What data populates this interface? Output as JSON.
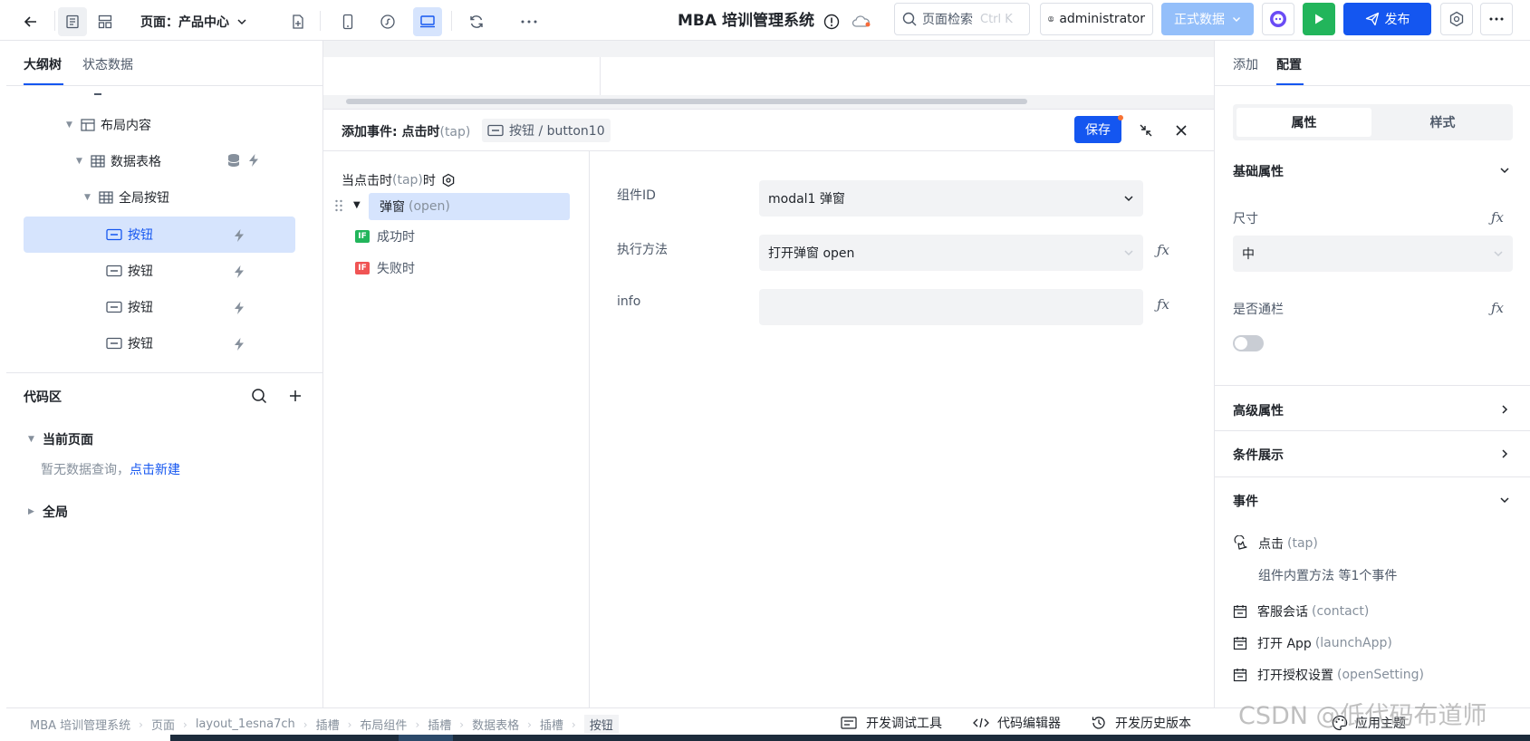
{
  "topbar": {
    "page_label": "页面：产品中心",
    "app_title": "MBA 培训管理系统",
    "search_placeholder": "页面检索",
    "search_shortcut": "Ctrl K",
    "user_name": "administrator",
    "env_label": "正式数据",
    "publish_label": "发布"
  },
  "left": {
    "tabs": [
      "大纲树",
      "状态数据"
    ],
    "tree": [
      {
        "label": "布局内容",
        "icon": "layout-icon"
      },
      {
        "label": "数据表格",
        "icon": "table-icon"
      },
      {
        "label": "全局按钮",
        "icon": "table-icon"
      },
      {
        "label": "按钮",
        "icon": "button-icon"
      },
      {
        "label": "按钮",
        "icon": "button-icon"
      },
      {
        "label": "按钮",
        "icon": "button-icon"
      },
      {
        "label": "按钮",
        "icon": "button-icon"
      }
    ],
    "code_area": {
      "title": "代码区",
      "current_page": "当前页面",
      "empty_text": "暂无数据查询，",
      "create_link": "点击新建",
      "global": "全局"
    }
  },
  "event_panel": {
    "title_prefix": "添加事件: 点击时",
    "title_code": "(tap)",
    "target_tag": "按钮 / button10",
    "save_label": "保存",
    "trigger_prefix": "当点击时",
    "trigger_code": "(tap)",
    "trigger_suffix": "时",
    "action_name": "弹窗",
    "action_code": "(open)",
    "branch_if": "IF",
    "success_label": "成功时",
    "fail_label": "失败时",
    "form": {
      "component_id_label": "组件ID",
      "component_id_value": "modal1 弹窗",
      "method_label": "执行方法",
      "method_value": "打开弹窗 open",
      "info_label": "info",
      "info_value": ""
    }
  },
  "right": {
    "tabs": [
      "添加",
      "配置"
    ],
    "segment": [
      "属性",
      "样式"
    ],
    "basic_title": "基础属性",
    "size_label": "尺寸",
    "size_value": "中",
    "full_bar_label": "是否通栏",
    "advanced_title": "高级属性",
    "condition_title": "条件展示",
    "events_title": "事件",
    "events": [
      {
        "name": "点击",
        "code": "(tap)"
      },
      {
        "name": "客服会话",
        "code": "(contact)"
      },
      {
        "name": "打开 App",
        "code": "(launchApp)"
      },
      {
        "name": "打开授权设置",
        "code": "(openSetting)"
      }
    ],
    "tap_detail": "组件内置方法 等1个事件"
  },
  "bottombar": {
    "breadcrumb": [
      "MBA 培训管理系统",
      "页面",
      "layout_1esna7ch",
      "插槽",
      "布局组件",
      "插槽",
      "数据表格",
      "插槽",
      "按钮"
    ],
    "tools": [
      "开发调试工具",
      "代码编辑器",
      "开发历史版本",
      "应用主题"
    ]
  },
  "watermark": "CSDN @低代码布道师",
  "colors": {
    "primary": "#1456f0",
    "selected_bg": "#d6e4fd",
    "run_green": "#22b55b",
    "if_success": "#22b55b",
    "if_fail": "#f05454"
  }
}
